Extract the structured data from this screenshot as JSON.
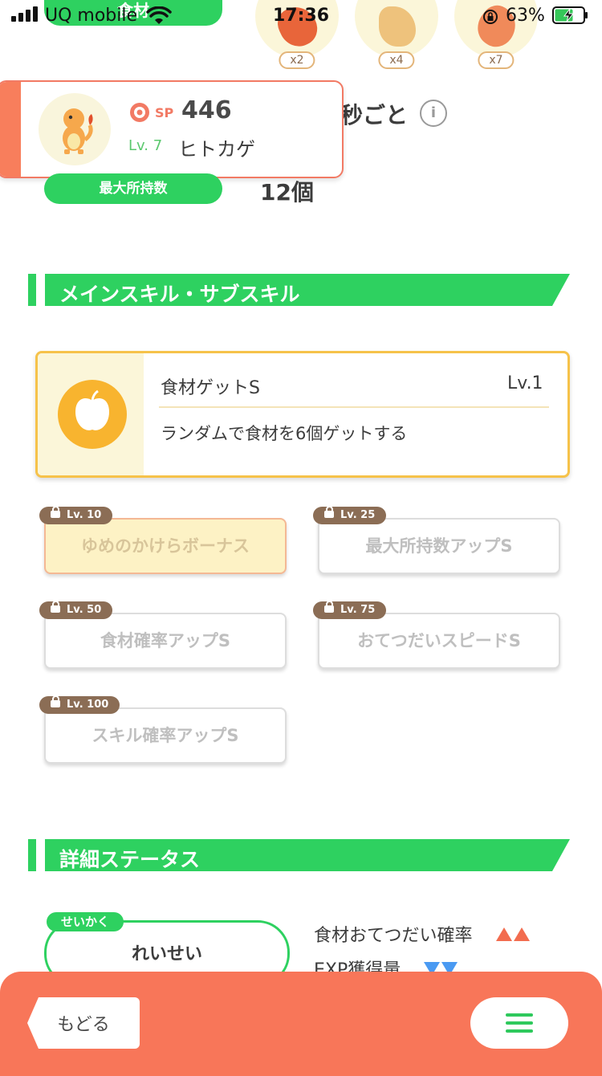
{
  "status_bar": {
    "carrier": "UQ mobile",
    "time": "17:36",
    "battery": "63%"
  },
  "ingredients": {
    "header_label": "食材",
    "items": [
      {
        "icon": "ingredient-roasted-icon",
        "count": "x2"
      },
      {
        "icon": "ingredient-ginger-icon",
        "count": "x4"
      },
      {
        "icon": "ingredient-sweet-potato-icon",
        "count": "x7"
      }
    ]
  },
  "pokemon": {
    "sp_label": "SP",
    "sp": "446",
    "level_label": "Lv. 7",
    "name": "ヒトカゲ",
    "frequency_suffix": "秒ごと"
  },
  "max_carry": {
    "label": "最大所持数",
    "value": "12個"
  },
  "sections": {
    "skills_title": "メインスキル・サブスキル",
    "details_title": "詳細ステータス"
  },
  "main_skill": {
    "name": "食材ゲットS",
    "level": "Lv.1",
    "description": "ランダムで食材を6個ゲットする"
  },
  "sub_skills": [
    {
      "unlock": "Lv. 10",
      "name": "ゆめのかけらボーナス"
    },
    {
      "unlock": "Lv. 25",
      "name": "最大所持数アップS"
    },
    {
      "unlock": "Lv. 50",
      "name": "食材確率アップS"
    },
    {
      "unlock": "Lv. 75",
      "name": "おてつだいスピードS"
    },
    {
      "unlock": "Lv. 100",
      "name": "スキル確率アップS"
    }
  ],
  "nature": {
    "tag": "せいかく",
    "value": "れいせい",
    "effect_up": "食材おてつだい確率",
    "effect_down": "EXP獲得量"
  },
  "colors": {
    "accent_green": "#2ed160",
    "bottom_bar": "#f87659",
    "gold_border": "#f6c24a"
  },
  "bottom_bar": {
    "back_label": "もどる",
    "menu_icon": "hamburger-menu-icon"
  }
}
